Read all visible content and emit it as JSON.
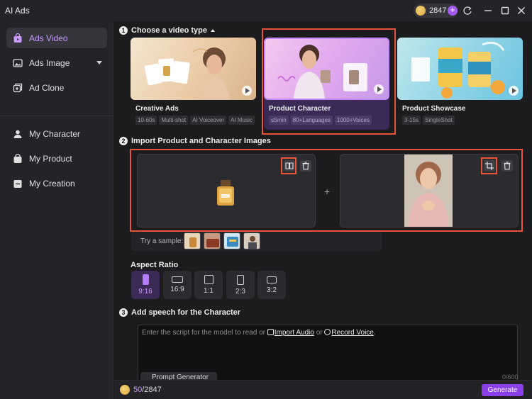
{
  "app": {
    "title": "AI Ads"
  },
  "titlebar": {
    "credits": "2847",
    "plus_icon": "+"
  },
  "sidebar": {
    "items": [
      {
        "label": "Ads Video",
        "icon": "bag-icon"
      },
      {
        "label": "Ads Image",
        "icon": "image-icon"
      },
      {
        "label": "Ad Clone",
        "icon": "clone-icon"
      },
      {
        "label": "My Character",
        "icon": "person-icon"
      },
      {
        "label": "My Product",
        "icon": "product-icon"
      },
      {
        "label": "My Creation",
        "icon": "folder-icon"
      }
    ]
  },
  "section1": {
    "step": "1",
    "title": "Choose a video type",
    "cards": [
      {
        "label": "Creative Ads",
        "tags": [
          "10-60s",
          "Multi-shot",
          "AI Voiceover",
          "AI Music"
        ]
      },
      {
        "label": "Product Character",
        "tags": [
          "≤5min",
          "80+Languages",
          "1000+Voices"
        ]
      },
      {
        "label": "Product Showcase",
        "tags": [
          "3-15s",
          "SingleShot"
        ]
      }
    ]
  },
  "section2": {
    "step": "2",
    "title": "Import Product and Character Images",
    "plus": "+",
    "sample_label": "Try a sample:"
  },
  "aspect": {
    "title": "Aspect Ratio",
    "options": [
      "9:16",
      "16:9",
      "1:1",
      "2:3",
      "3:2"
    ],
    "selected": "9:16"
  },
  "section3": {
    "step": "3",
    "title": "Add speech for the Character",
    "placeholder_pre": "Enter the script for the model to read or",
    "import_audio": "Import Audio",
    "or": "or",
    "record_voice": "Record Voice",
    "period": ".",
    "prompt_generator": "Prompt Generator",
    "counter": "0/600"
  },
  "footer": {
    "used": "50",
    "total": "/2847",
    "generate": "Generate"
  },
  "colors": {
    "accent": "#8a3fe8",
    "highlight": "#e8553a",
    "selected": "#c99bff"
  }
}
